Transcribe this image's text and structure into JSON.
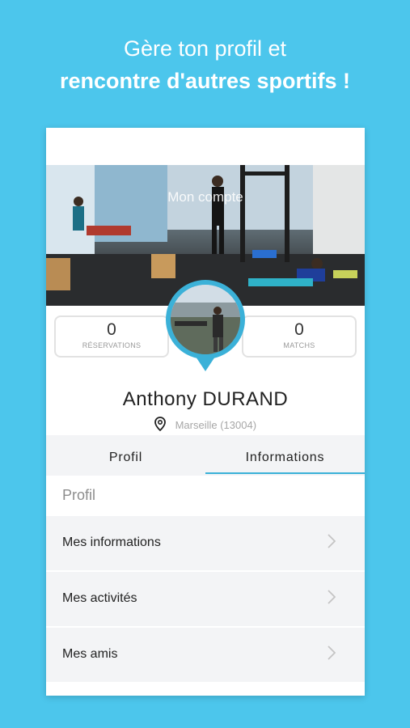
{
  "promo": {
    "line1": "Gère ton profil et",
    "line2": "rencontre d'autres sportifs !"
  },
  "header": {
    "title": "Mon compte"
  },
  "stats": {
    "reservations": {
      "value": "0",
      "label": "RÉSERVATIONS"
    },
    "matchs": {
      "value": "0",
      "label": "MATCHS"
    }
  },
  "profile": {
    "name": "Anthony DURAND",
    "location": "Marseille (13004)"
  },
  "tabs": [
    {
      "label": "Profil",
      "active": false
    },
    {
      "label": "Informations",
      "active": true
    }
  ],
  "section": {
    "label": "Profil"
  },
  "menu": [
    {
      "label": "Mes informations",
      "icon": "chevron-right-icon"
    },
    {
      "label": "Mes activités",
      "icon": "chevron-right-icon"
    },
    {
      "label": "Mes amis",
      "icon": "chevron-right-icon"
    }
  ],
  "colors": {
    "background": "#4cc6ec",
    "accent": "#3bb1d8",
    "menu_bg": "#f3f4f6"
  }
}
